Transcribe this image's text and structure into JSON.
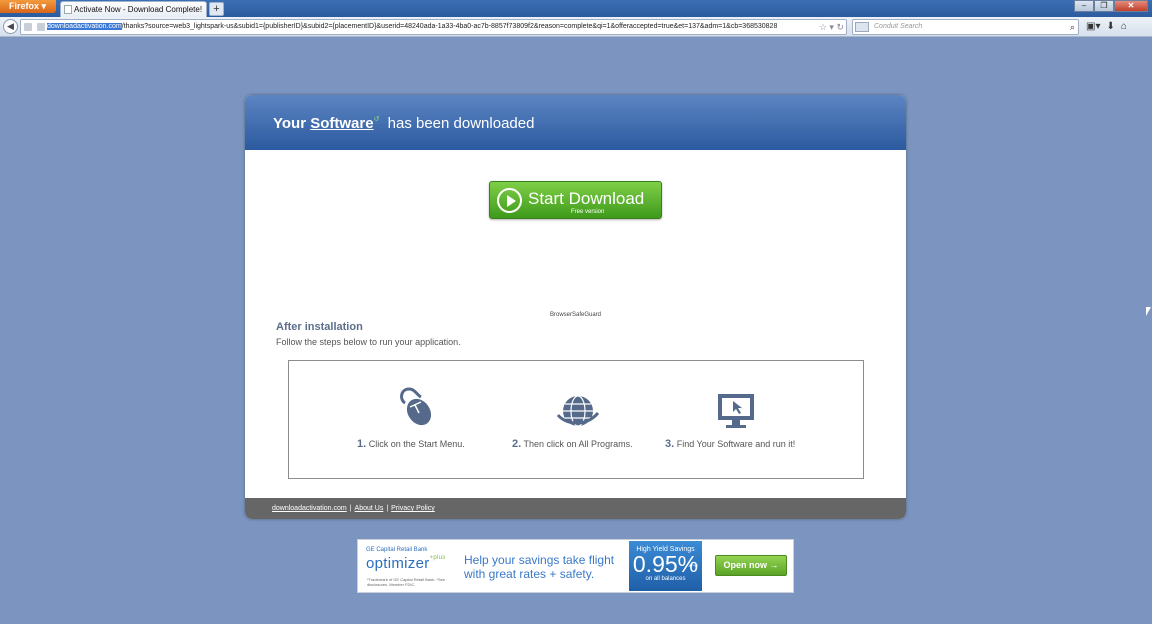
{
  "browser": {
    "menu_label": "Firefox",
    "tab_title": "Activate Now - Download Complete!",
    "new_tab_label": "+",
    "url_domain": "downloadactivation.com",
    "url_rest": "/thanks?source=web3_lightspark-us&subid1={publisherID}&subid2={placementID}&userid=48240ada-1a33-4ba0-ac7b-8857f73809f2&reason=complete&qi=1&offeraccepted=true&et=137&adm=1&cb=368530828",
    "search_placeholder": "Conduit Search"
  },
  "header": {
    "prefix": "Your",
    "software": "Software",
    "suffix": "has been downloaded"
  },
  "download": {
    "label": "Start Download",
    "sub": "Free version"
  },
  "product_name": "BrowserSafeGuard",
  "after": {
    "title": "After installation",
    "subtitle": "Follow the steps below to run your application."
  },
  "steps": [
    {
      "num": "1.",
      "text": "Click on the Start Menu.",
      "icon": "mouse-icon"
    },
    {
      "num": "2.",
      "text": "Then click on All Programs.",
      "icon": "globe-icon"
    },
    {
      "num": "3.",
      "text": "Find Your Software and run it!",
      "icon": "monitor-icon"
    }
  ],
  "footer": {
    "links": [
      "downloadactivation.com",
      "About Us",
      "Privacy Policy"
    ],
    "separator": "|"
  },
  "ad": {
    "bank": "GE Capital Retail Bank",
    "brand": "optimizer",
    "brand_plus": "+plus",
    "fine_print": "*Trademark of GE Capital Retail Bank. *See disclosures. Member FDIC.",
    "headline_1": "Help your savings take flight",
    "headline_2": "with great rates + safety.",
    "box_title": "High Yield Savings",
    "rate": "0.95%",
    "apy": "APY*",
    "box_sub": "on all balances",
    "cta": "Open now →"
  },
  "colors": {
    "page_bg": "#7b95c0",
    "header_blue": "#2c5aa0",
    "download_green": "#4fae28",
    "footer_gray": "#666666"
  }
}
